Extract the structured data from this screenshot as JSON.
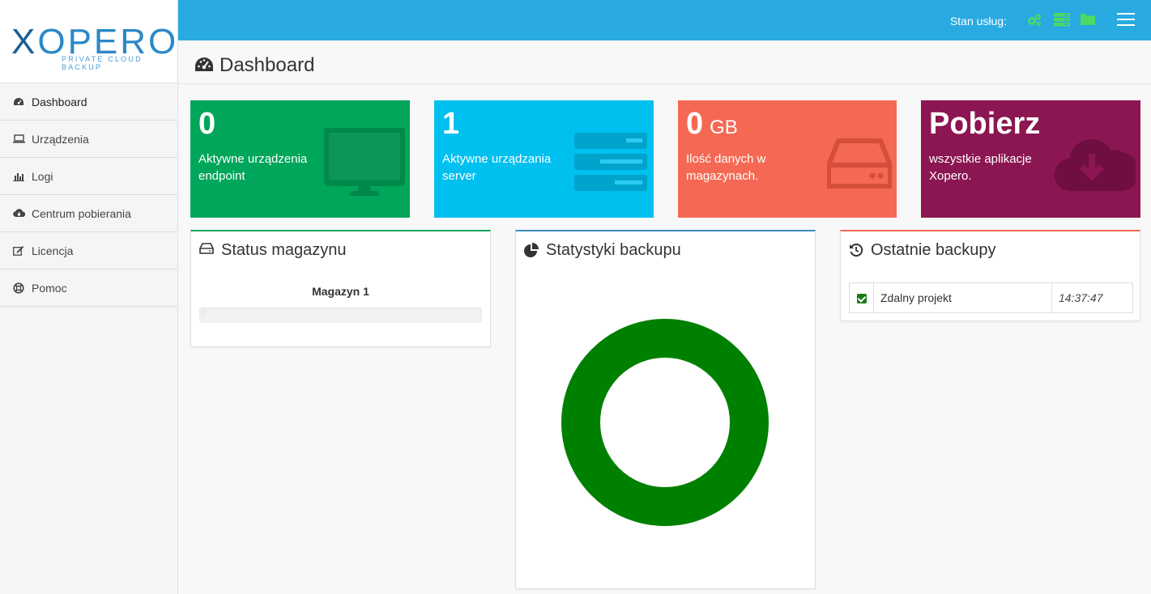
{
  "logo": {
    "word_x": "X",
    "word_rest": "OPERO",
    "tagline": "PRIVATE CLOUD BACKUP"
  },
  "sidebar": {
    "items": [
      {
        "label": "Dashboard",
        "icon": "dashboard-icon",
        "active": true
      },
      {
        "label": "Urządzenia",
        "icon": "laptop-icon"
      },
      {
        "label": "Logi",
        "icon": "bar-chart-icon"
      },
      {
        "label": "Centrum pobierania",
        "icon": "cloud-download-icon"
      },
      {
        "label": "Licencja",
        "icon": "edit-icon"
      },
      {
        "label": "Pomoc",
        "icon": "life-ring-icon"
      }
    ]
  },
  "topbar": {
    "status_label": "Stan usług:",
    "status_icons": [
      "gears-icon",
      "server-icon",
      "folder-icon"
    ],
    "status_color": "#4cd964",
    "menu_icon": "hamburger-icon"
  },
  "header": {
    "title": "Dashboard",
    "icon": "dashboard-icon"
  },
  "tiles": [
    {
      "value": "0",
      "unit": "",
      "label": "Aktywne urządzenia endpoint",
      "color": "#00a65a",
      "icon": "monitor-icon"
    },
    {
      "value": "1",
      "unit": "",
      "label": "Aktywne urządzania server",
      "color": "#00c0ef",
      "icon": "server-stack-icon"
    },
    {
      "value": "0",
      "unit": "GB",
      "label": "Ilość danych w magazynach.",
      "color": "#f56954",
      "icon": "hard-drive-icon"
    },
    {
      "value": "Pobierz",
      "unit": "",
      "label": "wszystkie aplikacje Xopero.",
      "color": "#8b1651",
      "icon": "cloud-download-icon"
    }
  ],
  "panels": {
    "storage": {
      "title": "Status magazynu",
      "icon": "hdd-icon",
      "border_color": "#00a65a",
      "magazyn_name": "Magazyn 1",
      "progress_value": "0"
    },
    "stats": {
      "title": "Statystyki backupu",
      "icon": "pie-chart-icon",
      "border_color": "#3c8dbc"
    },
    "recent": {
      "title": "Ostatnie backupy",
      "icon": "history-icon",
      "border_color": "#f56954",
      "rows": [
        {
          "name": "Zdalny projekt",
          "time": "14:37:47",
          "checked": true
        }
      ]
    }
  },
  "chart_data": {
    "type": "pie",
    "categories": [
      ""
    ],
    "values": [
      1
    ],
    "colors": [
      "#008000"
    ],
    "style": "donut"
  }
}
